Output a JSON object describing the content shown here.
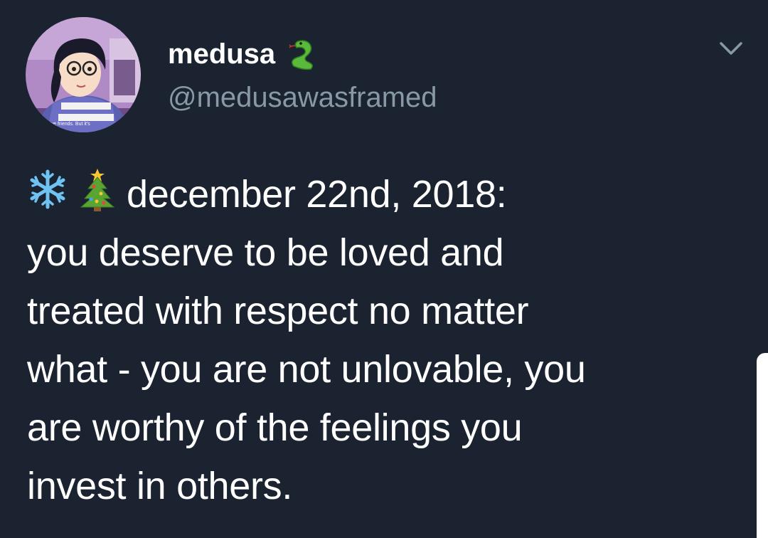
{
  "user": {
    "display_name": "medusa",
    "handle": "@medusawasframed",
    "name_emoji": "snake-icon",
    "avatar_caption": "t have friends. But it's"
  },
  "tweet": {
    "emoji": [
      "snowflake-icon",
      "christmas-tree-icon"
    ],
    "lines": [
      "december 22nd, 2018:",
      "you deserve to be loved and",
      "treated with respect no matter",
      "what - you are not unlovable, you",
      "are worthy of the feelings you",
      "invest in others."
    ]
  },
  "menu": {
    "icon": "chevron-down-icon"
  },
  "colors": {
    "background": "#1b2330",
    "text": "#ffffff",
    "handle": "#8899a6",
    "chevron": "#8899a6"
  }
}
